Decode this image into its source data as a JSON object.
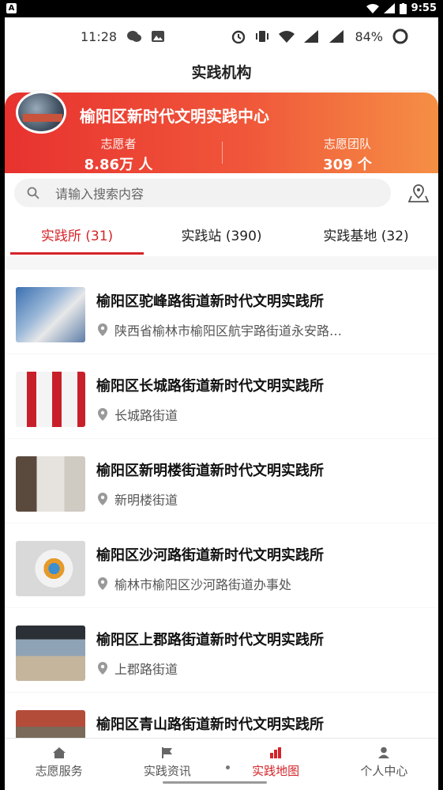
{
  "outer_status": {
    "time": "9:55",
    "app_badge": "A"
  },
  "inner_status": {
    "time": "11:28",
    "battery": "84%"
  },
  "header": {
    "title": "实践机构"
  },
  "banner": {
    "title": "榆阳区新时代文明实践中心",
    "stats": [
      {
        "label": "志愿者",
        "value": "8.86万 人"
      },
      {
        "label": "志愿团队",
        "value": "309 个"
      }
    ]
  },
  "search": {
    "placeholder": "请输入搜索内容"
  },
  "tabs": [
    {
      "label": "实践所 (31)",
      "active": true
    },
    {
      "label": "实践站 (390)",
      "active": false
    },
    {
      "label": "实践基地 (32)",
      "active": false
    }
  ],
  "list": [
    {
      "name": "榆阳区驼峰路街道新时代文明实践所",
      "address": "陕西省榆林市榆阳区航宇路街道永安路…"
    },
    {
      "name": "榆阳区长城路街道新时代文明实践所",
      "address": "长城路街道"
    },
    {
      "name": "榆阳区新明楼街道新时代文明实践所",
      "address": "新明楼街道"
    },
    {
      "name": "榆阳区沙河路街道新时代文明实践所",
      "address": "榆林市榆阳区沙河路街道办事处"
    },
    {
      "name": "榆阳区上郡路街道新时代文明实践所",
      "address": "上郡路街道"
    },
    {
      "name": "榆阳区青山路街道新时代文明实践所",
      "address": ""
    }
  ],
  "bottom_nav": [
    {
      "label": "志愿服务",
      "icon": "home-icon",
      "active": false
    },
    {
      "label": "实践资讯",
      "icon": "flag-icon",
      "active": false
    },
    {
      "label": "实践地图",
      "icon": "chart-icon",
      "active": true
    },
    {
      "label": "个人中心",
      "icon": "person-icon",
      "active": false
    }
  ],
  "colors": {
    "accent": "#d4242a",
    "banner_start": "#e8322f",
    "banner_end": "#f58f45"
  }
}
